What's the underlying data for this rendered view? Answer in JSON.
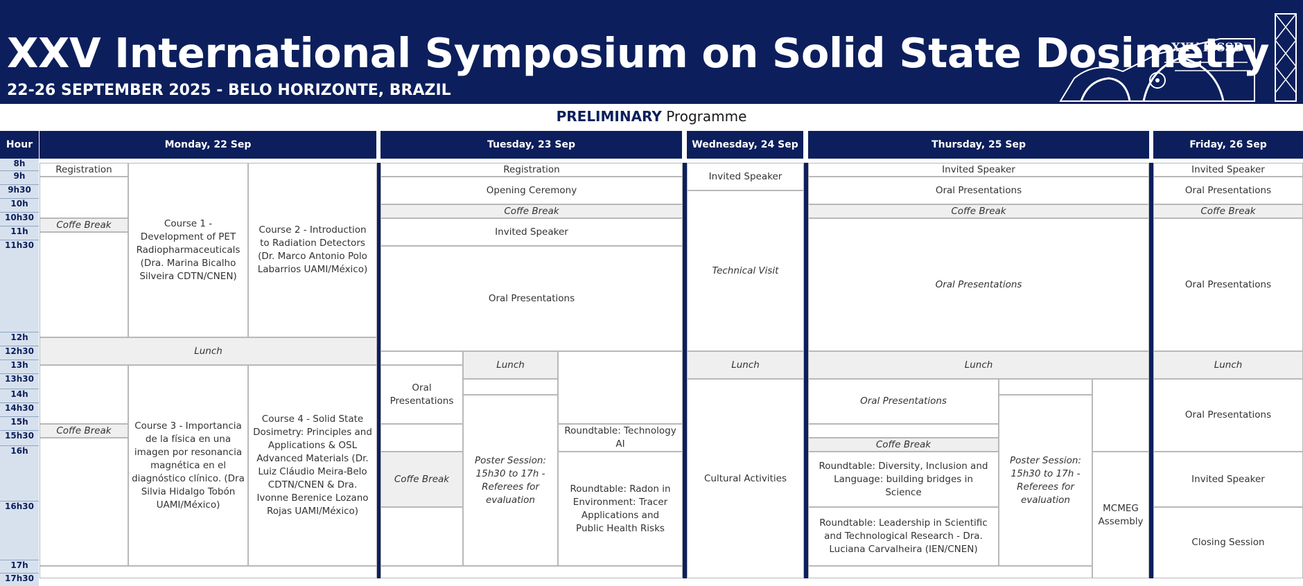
{
  "header": {
    "title": "XXV International Symposium on Solid State Dosimetry",
    "subtitle": "22-26 SEPTEMBER 2025 - BELO HORIZONTE, BRAZIL",
    "logo_text": "XXV ISSSD"
  },
  "programme": {
    "bold": "PRELIMINARY",
    "rest": " Programme"
  },
  "hour_header": "Hour",
  "days": {
    "mon": "Monday, 22 Sep",
    "tue": "Tuesday, 23 Sep",
    "wed": "Wednesday, 24 Sep",
    "thu": "Thursday, 25 Sep",
    "fri": "Friday, 26 Sep"
  },
  "hours": [
    "8h",
    "9h",
    "9h30",
    "10h",
    "10h30",
    "11h",
    "11h30",
    "12h",
    "12h30",
    "13h",
    "13h30",
    "14h",
    "14h30",
    "15h",
    "15h30",
    "16h",
    "16h30",
    "17h",
    "17h30"
  ],
  "sessions": {
    "registration": "Registration",
    "coffee": "Coffe Break",
    "lunch": "Lunch",
    "opening": "Opening Ceremony",
    "invited": "Invited Speaker",
    "oral": "Oral Presentations",
    "tech_visit": "Technical Visit",
    "cultural": "Cultural Activities",
    "closing": "Closing Session",
    "course1": "Course 1 - Development of PET Radiopharmaceuticals (Dra. Marina Bicalho Silveira CDTN/CNEN)",
    "course2": "Course 2 - Introduction to Radiation Detectors (Dr. Marco Antonio Polo Labarrios UAMI/México)",
    "course3": "Course 3 - Importancia de la física en una imagen por resonancia magnética en el diagnóstico clínico. (Dra Silvia Hidalgo Tobón UAMI/México)",
    "course4": "Course 4 - Solid State Dosimetry: Principles and Applications & OSL Advanced Materials (Dr. Luiz Cláudio Meira-Belo CDTN/CNEN & Dra. Ivonne Berenice Lozano Rojas UAMI/México)",
    "oral_split": "Oral Presentations",
    "poster": "Poster Session: 15h30 to 17h - Referees for evaluation",
    "rt_tech": "Roundtable: Technology AI",
    "rt_radon": "Roundtable: Radon in Environment: Tracer Applications and Public Health Risks",
    "rt_diversity": "Roundtable: Diversity, Inclusion and Language: building bridges in Science",
    "rt_leadership": "Roundtable: Leadership in Scientific and Technological Research - Dra. Luciana Carvalheira (IEN/CNEN)",
    "mcmeg": "MCMEG Assembly"
  },
  "colors": {
    "navy": "#0c1f5c",
    "hour_bg": "#d7e1ee",
    "grey_cell": "#efefef"
  }
}
